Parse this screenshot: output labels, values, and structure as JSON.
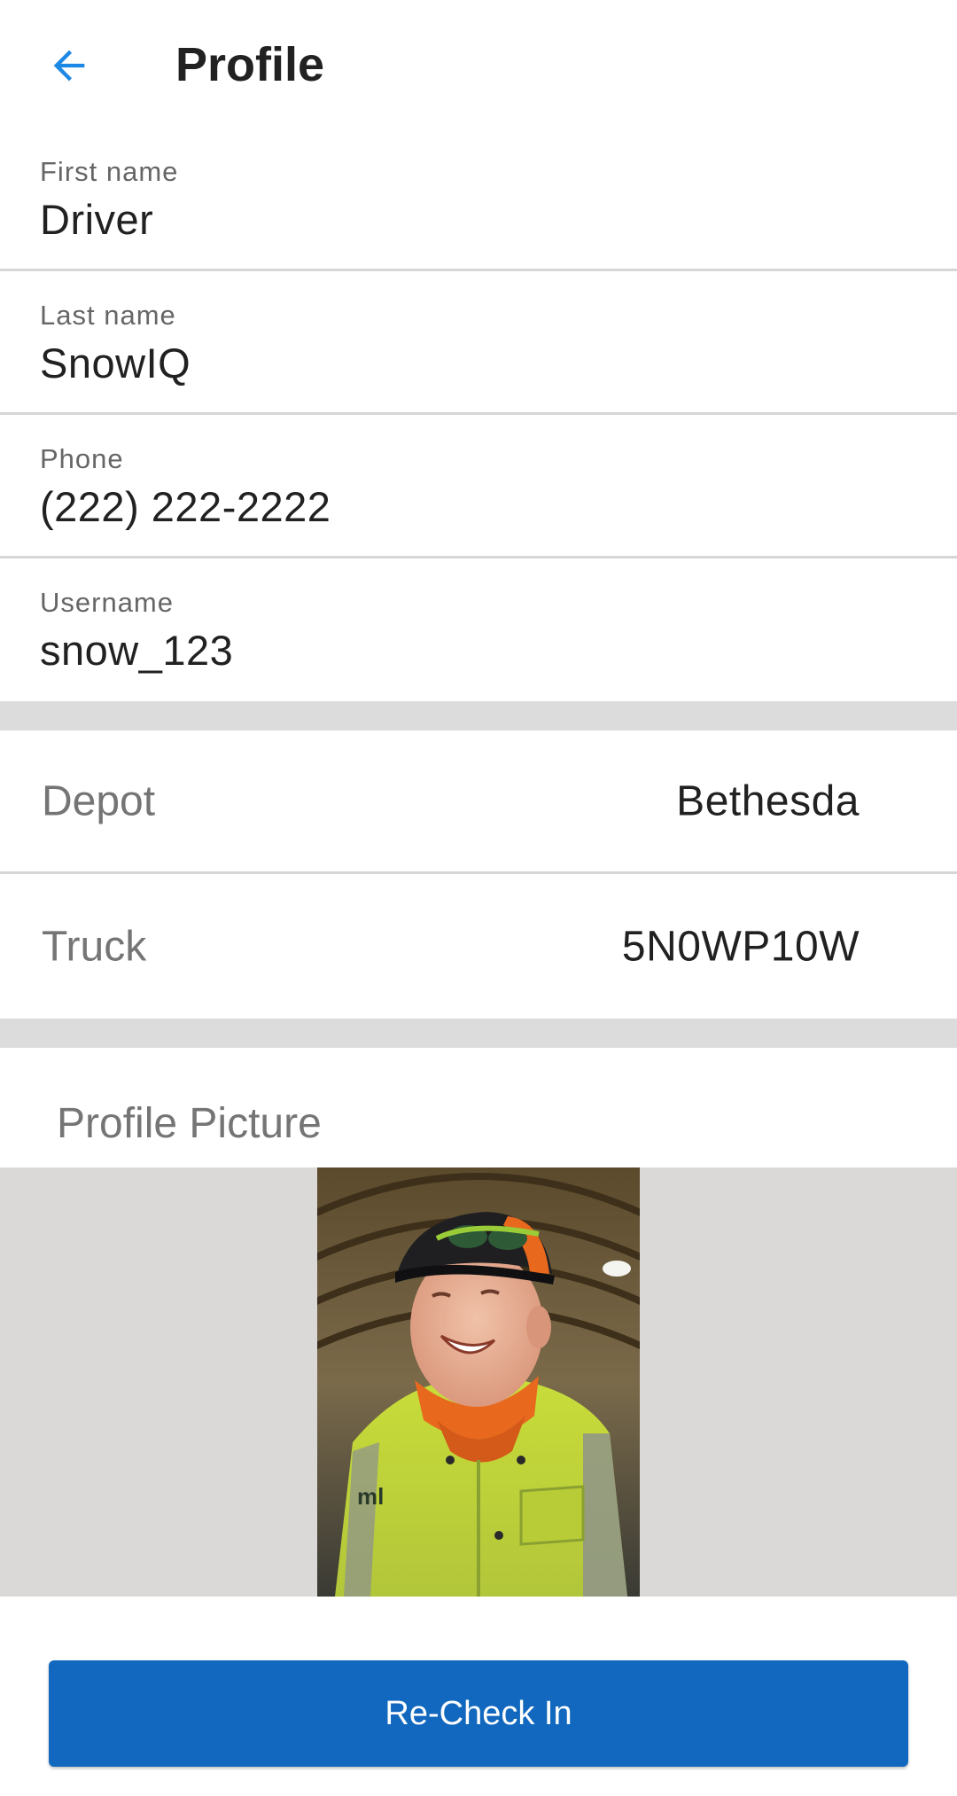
{
  "header": {
    "title": "Profile",
    "back_icon": "arrow-left-icon",
    "accent": "#1e88e5"
  },
  "fields": [
    {
      "label": "First name",
      "value": "Driver"
    },
    {
      "label": "Last name",
      "value": "SnowIQ"
    },
    {
      "label": "Phone",
      "value": "(222) 222-2222"
    },
    {
      "label": "Username",
      "value": "snow_123"
    }
  ],
  "details": [
    {
      "label": "Depot",
      "value": "Bethesda"
    },
    {
      "label": "Truck",
      "value": "5N0WP10W"
    }
  ],
  "profile_picture": {
    "label": "Profile Picture",
    "photo_icon": "driver-photo"
  },
  "button": {
    "label": "Re-Check In",
    "color": "#1268be"
  }
}
